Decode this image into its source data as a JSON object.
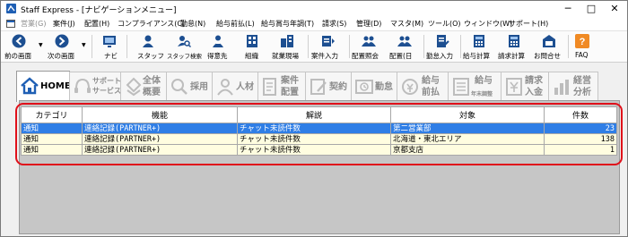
{
  "window": {
    "title": "Staff Express - [ナビゲーションメニュー]",
    "minimize": "─",
    "maximize": "□",
    "close": "✕"
  },
  "menu": [
    {
      "label": "営業(G)",
      "disabled": true
    },
    {
      "label": "案件(J)"
    },
    {
      "label": "配置(H)"
    },
    {
      "label": "コンプライアンス(C)"
    },
    {
      "label": "勤怠(N)"
    },
    {
      "label": "給与前払(L)"
    },
    {
      "label": "給与賞与年調(T)"
    },
    {
      "label": "請求(S)"
    },
    {
      "label": "管理(D)"
    },
    {
      "label": "マスタ(M)"
    },
    {
      "label": "ツール(O)"
    },
    {
      "label": "ウィンドウ(W)"
    },
    {
      "label": "サポート(H)"
    }
  ],
  "toolbar": {
    "back": "前の画面",
    "forward": "次の画面",
    "navi": "ナビ",
    "staff": "スタッフ",
    "staff_search": "スタッフ検索",
    "client": "得意先",
    "org": "組織",
    "worksite": "就業現場",
    "job_entry": "案件入力",
    "placement_inquiry": "配置照会",
    "placement_day": "配置(日",
    "attendance_entry": "勤怠入力",
    "payroll_calc": "給与計算",
    "billing_calc": "請求計算",
    "inquiry": "お問合せ",
    "faq": "FAQ"
  },
  "tabs": [
    {
      "label": "HOME",
      "active": true
    },
    {
      "label1": "サポート",
      "label2": "サービス"
    },
    {
      "label1": "全体",
      "label2": "概要"
    },
    {
      "label": "採用"
    },
    {
      "label": "人材"
    },
    {
      "label1": "案件",
      "label2": "配置"
    },
    {
      "label": "契約"
    },
    {
      "label": "勤怠"
    },
    {
      "label1": "給与",
      "label2": "前払"
    },
    {
      "label1": "給与",
      "label2": "年末調整"
    },
    {
      "label1": "請求",
      "label2": "入金"
    },
    {
      "label1": "経営",
      "label2": "分析"
    }
  ],
  "grid": {
    "columns": [
      "カテゴリ",
      "機能",
      "解説",
      "対象",
      "件数"
    ],
    "rows": [
      {
        "category": "通知",
        "feature": "連絡記録(PARTNER+)",
        "description": "チャット未読件数",
        "target": "第二営業部",
        "count": "23",
        "selected": true
      },
      {
        "category": "通知",
        "feature": "連絡記録(PARTNER+)",
        "description": "チャット未読件数",
        "target": "北海道・東北エリア",
        "count": "138"
      },
      {
        "category": "通知",
        "feature": "連絡記録(PARTNER+)",
        "description": "チャット未読件数",
        "target": "京都支店",
        "count": "1"
      }
    ]
  },
  "colors": {
    "accent": "#1f5fb4",
    "selected_row": "#2f7ee6",
    "row_bg": "#fffde0",
    "highlight": "#e0101a"
  }
}
